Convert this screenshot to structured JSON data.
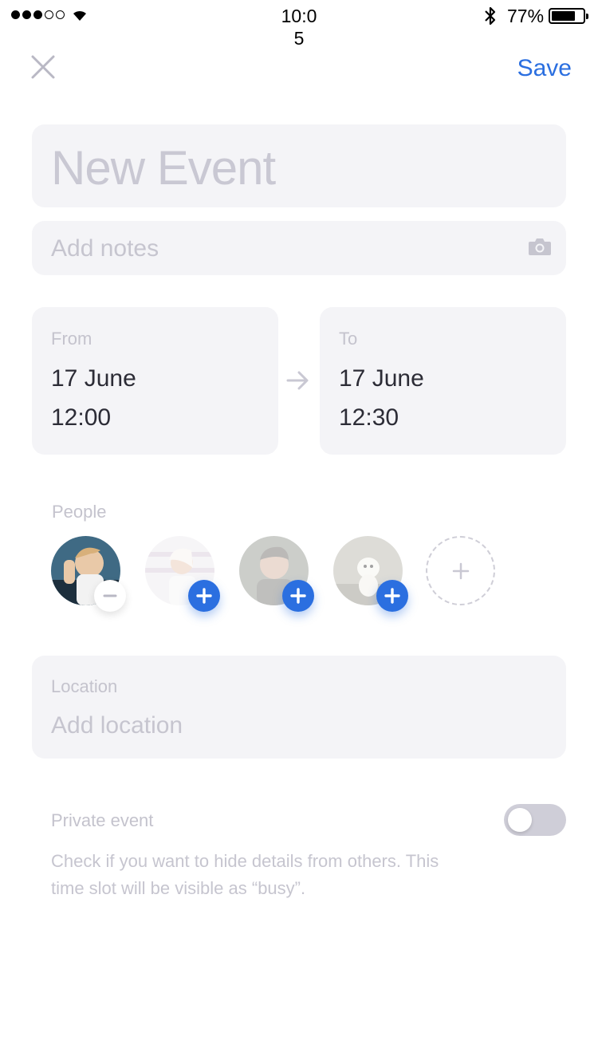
{
  "status_bar": {
    "time": "10:0\n5",
    "battery": "77%",
    "battery_level": 0.77
  },
  "nav": {
    "close_icon": "close-icon",
    "save_label": "Save"
  },
  "event": {
    "title_placeholder": "New Event",
    "notes_placeholder": "Add notes",
    "from_label": "From",
    "from_date": "17 June",
    "from_time": "12:00",
    "to_label": "To",
    "to_date": "17 June",
    "to_time": "12:30"
  },
  "people": {
    "label": "People",
    "avatars": [
      {
        "state": "added",
        "action_icon": "minus-icon"
      },
      {
        "state": "suggested",
        "action_icon": "plus-icon"
      },
      {
        "state": "suggested",
        "action_icon": "plus-icon"
      },
      {
        "state": "suggested",
        "action_icon": "plus-icon"
      }
    ],
    "add_icon": "plus-icon"
  },
  "location": {
    "label": "Location",
    "placeholder": "Add location"
  },
  "private_event": {
    "label": "Private event",
    "enabled": false,
    "description": "Check if you want to hide details from others. This time slot will be visible as “busy”."
  },
  "colors": {
    "accent": "#2b6fe0",
    "field_bg": "#f4f4f7",
    "placeholder": "#c6c5cf",
    "toggle_off": "#cfced8"
  }
}
